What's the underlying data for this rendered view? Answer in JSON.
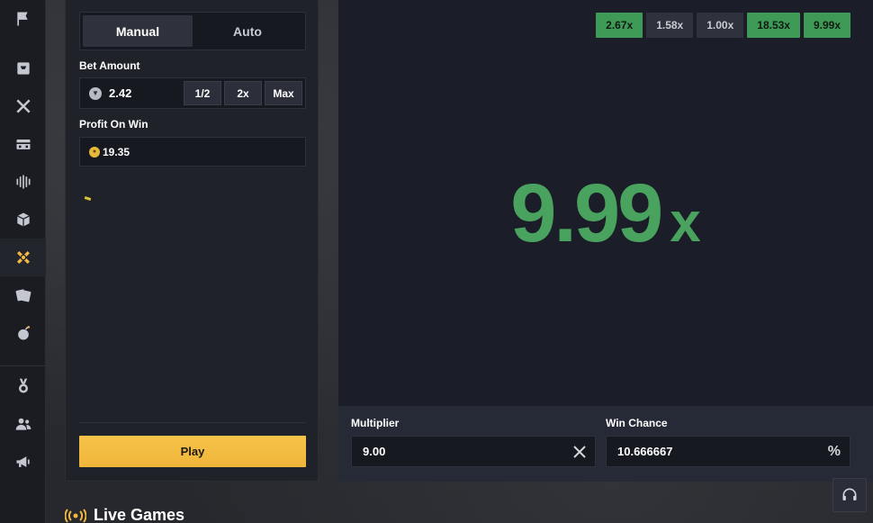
{
  "sidebar": {
    "items": [
      {
        "icon": "flag-icon",
        "active": false
      },
      {
        "icon": "inbox-icon",
        "active": false
      },
      {
        "icon": "crossed-swords-icon",
        "active": false
      },
      {
        "icon": "storefront-icon",
        "active": false
      },
      {
        "icon": "bars-icon",
        "active": false
      },
      {
        "icon": "box-icon",
        "active": false
      },
      {
        "icon": "dice-game-icon",
        "active": true
      },
      {
        "icon": "cards-icon",
        "active": false
      },
      {
        "icon": "bomb-icon",
        "active": false
      },
      {
        "icon": "medal-icon",
        "active": false
      },
      {
        "icon": "users-icon",
        "active": false
      },
      {
        "icon": "megaphone-icon",
        "active": false
      }
    ],
    "accent_color": "#f2b840"
  },
  "controls": {
    "tabs": [
      "Manual",
      "Auto"
    ],
    "active_tab": "Manual",
    "bet_amount_label": "Bet Amount",
    "bet_amount_value": "2.42",
    "half_label": "1/2",
    "double_label": "2x",
    "max_label": "Max",
    "profit_label": "Profit On Win",
    "profit_value": "19.35",
    "play_label": "Play"
  },
  "game": {
    "history": [
      {
        "value": "2.67x",
        "win": true
      },
      {
        "value": "1.58x",
        "win": false
      },
      {
        "value": "1.00x",
        "win": false
      },
      {
        "value": "18.53x",
        "win": true
      },
      {
        "value": "9.99x",
        "win": true
      }
    ],
    "result_number": "9.99",
    "result_suffix": "x",
    "result_color": "#49a35e",
    "multiplier_label": "Multiplier",
    "multiplier_value": "9.00",
    "win_chance_label": "Win Chance",
    "win_chance_value": "10.666667",
    "win_chance_suffix": "%"
  },
  "footer": {
    "live_games_title": "Live Games"
  }
}
